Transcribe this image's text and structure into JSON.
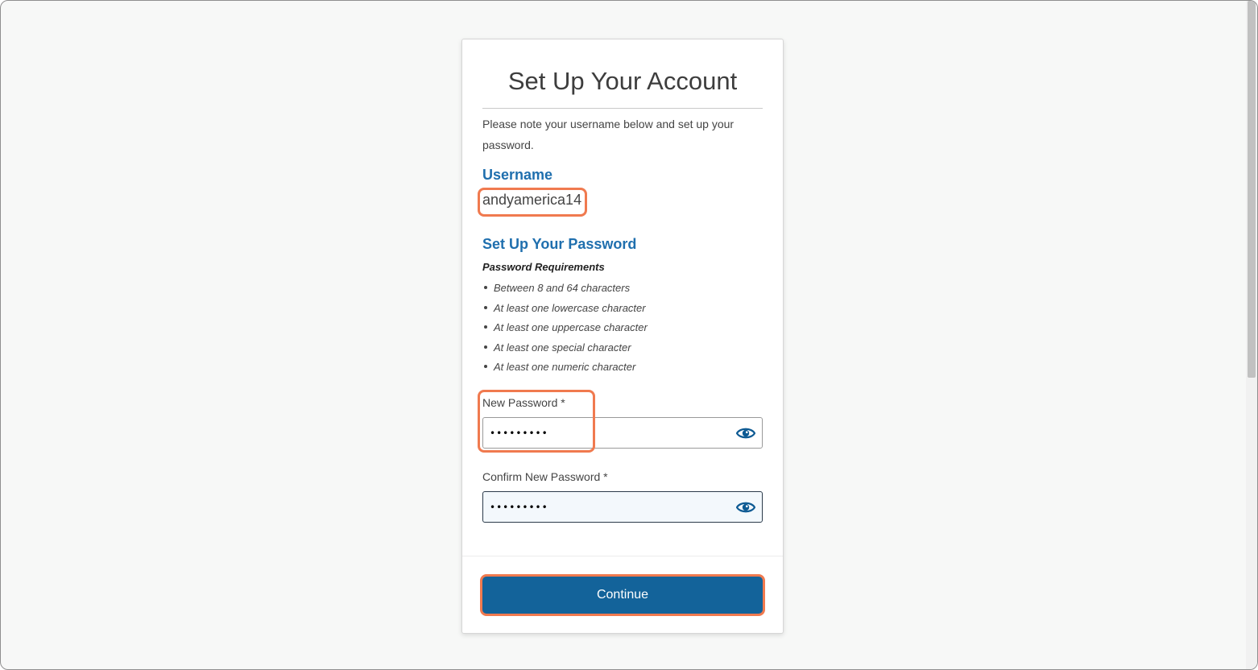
{
  "card": {
    "title": "Set Up Your Account",
    "intro": "Please note your username below and set up your password."
  },
  "username": {
    "label": "Username",
    "value": "andyamerica14"
  },
  "password_section": {
    "heading": "Set Up Your Password",
    "requirements_title": "Password Requirements",
    "requirements": [
      "Between 8 and 64 characters",
      "At least one lowercase character",
      "At least one uppercase character",
      "At least one special character",
      "At least one numeric character"
    ]
  },
  "new_password": {
    "label": "New Password *",
    "value": "•••••••••",
    "toggle_icon": "eye-icon"
  },
  "confirm_password": {
    "label": "Confirm New Password *",
    "value": "•••••••••",
    "toggle_icon": "eye-icon"
  },
  "actions": {
    "continue_label": "Continue"
  },
  "colors": {
    "accent": "#1f6fae",
    "button": "#13639a",
    "highlight": "#f07a4f"
  }
}
